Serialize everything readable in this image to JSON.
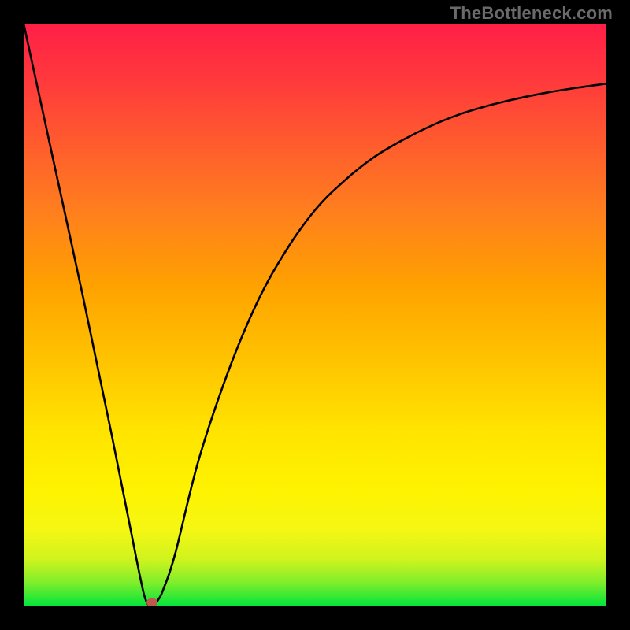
{
  "attribution": "TheBottleneck.com",
  "chart_data": {
    "type": "line",
    "title": "",
    "xlabel": "",
    "ylabel": "",
    "xlim": [
      0,
      100
    ],
    "ylim": [
      0,
      100
    ],
    "series": [
      {
        "name": "bottleneck-curve",
        "x": [
          0,
          5,
          10,
          15,
          18,
          20,
          21,
          22,
          23,
          24,
          26,
          30,
          35,
          40,
          45,
          50,
          55,
          60,
          65,
          70,
          75,
          80,
          85,
          90,
          95,
          100
        ],
        "values": [
          100,
          77,
          54,
          30,
          15,
          5,
          1,
          0,
          1,
          3,
          9,
          25,
          40,
          52,
          61,
          68,
          73,
          77,
          80,
          82.5,
          84.5,
          86,
          87.2,
          88.2,
          89,
          89.7
        ]
      }
    ],
    "optimal_x": 22,
    "gradient_stops": [
      {
        "pos": 0,
        "color": "#00e53b"
      },
      {
        "pos": 20,
        "color": "#fef300"
      },
      {
        "pos": 55,
        "color": "#ffa200"
      },
      {
        "pos": 100,
        "color": "#ff1f47"
      }
    ]
  }
}
